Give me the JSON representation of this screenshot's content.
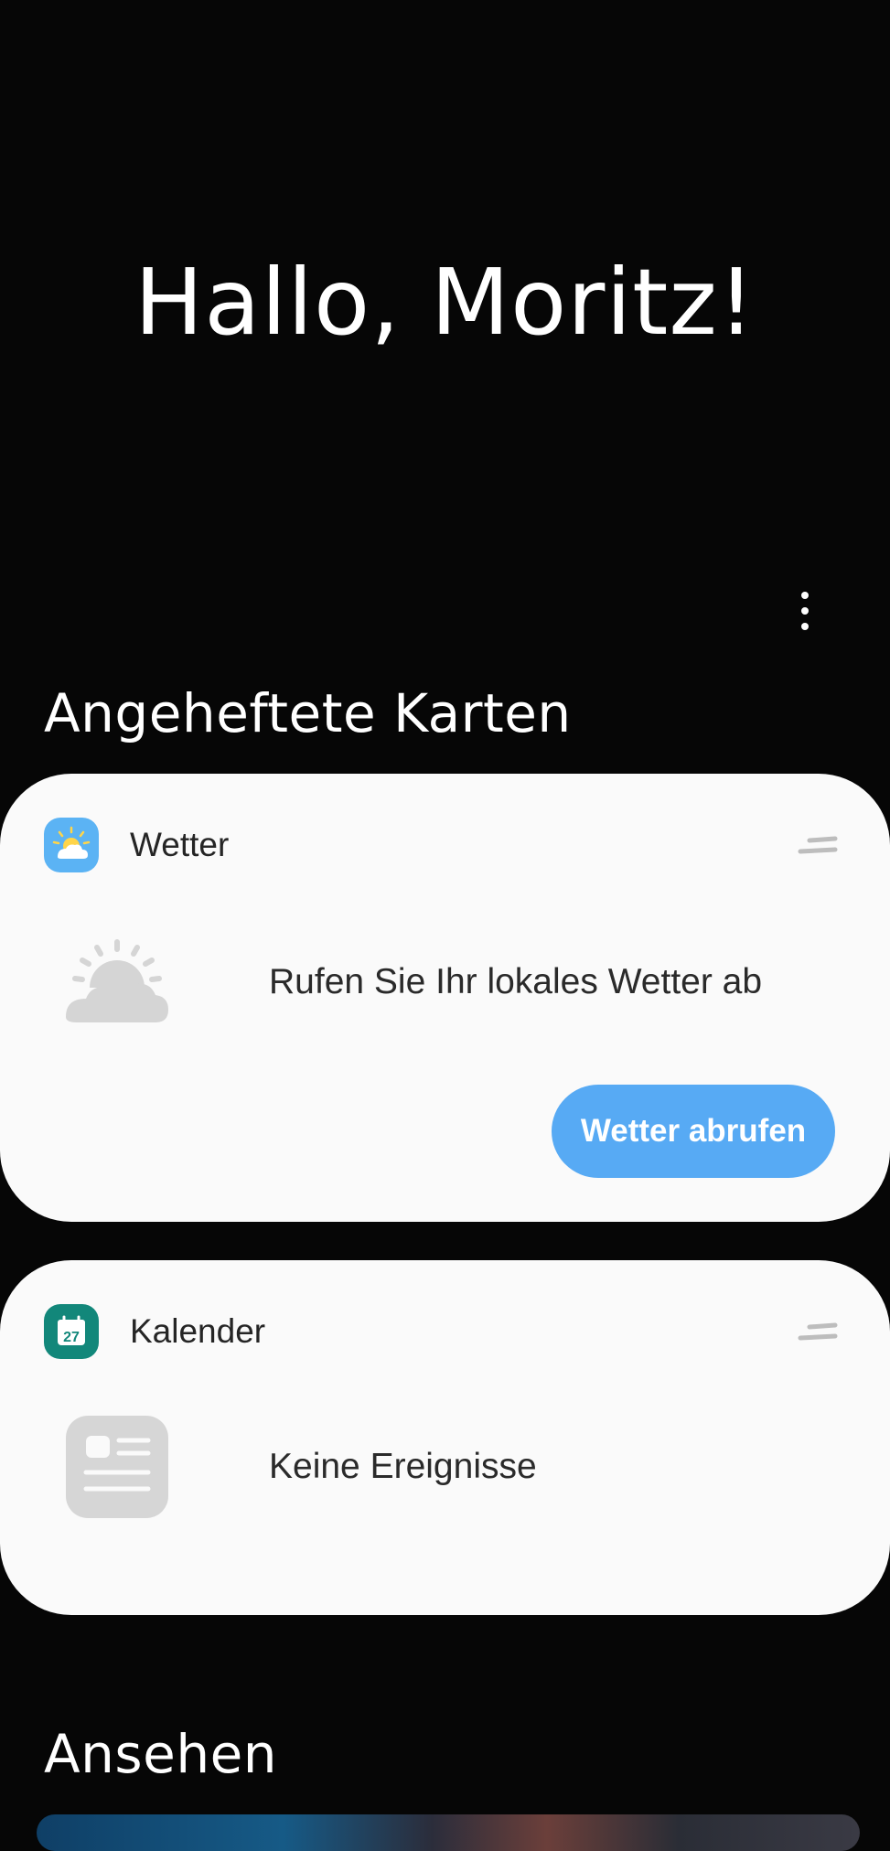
{
  "greeting": "Hallo, Moritz!",
  "menu": {
    "icon": "more-vertical-icon"
  },
  "pinned_section": {
    "title": "Angeheftete Karten"
  },
  "cards": {
    "weather": {
      "name": "Wetter",
      "icon": "weather-app-icon",
      "illustration": "partly-cloudy-icon",
      "message": "Rufen Sie Ihr lokales Wetter ab",
      "button_label": "Wetter abrufen",
      "accent": "#57aaf4"
    },
    "calendar": {
      "name": "Kalender",
      "icon": "calendar-app-icon",
      "icon_day": "27",
      "illustration": "news-placeholder-icon",
      "message": "Keine Ereignisse",
      "accent": "#12877a"
    }
  },
  "watch_section": {
    "title": "Ansehen"
  },
  "colors": {
    "background": "#060606",
    "card": "#fafafa",
    "text_dark": "#252525"
  }
}
